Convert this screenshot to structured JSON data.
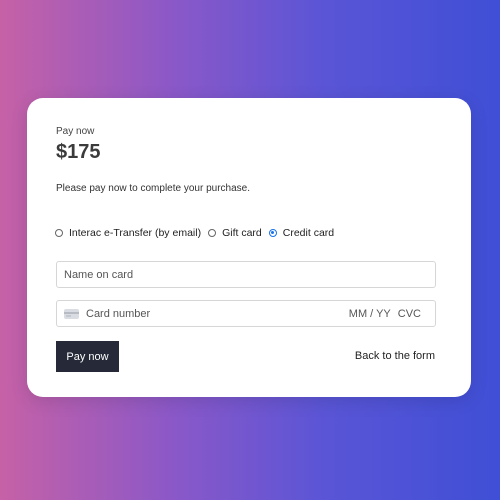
{
  "payment": {
    "label": "Pay now",
    "amount": "$175",
    "description": "Please pay now to complete your purchase."
  },
  "methods": [
    {
      "label": "Interac e-Transfer (by email)",
      "selected": false
    },
    {
      "label": "Gift card",
      "selected": false
    },
    {
      "label": "Credit card",
      "selected": true
    }
  ],
  "form": {
    "name_placeholder": "Name on card",
    "card_number_placeholder": "Card number",
    "expiry_placeholder": "MM / YY",
    "cvc_placeholder": "CVC"
  },
  "actions": {
    "pay_button": "Pay now",
    "back_link": "Back to the form"
  },
  "colors": {
    "button_bg": "#262a38",
    "radio_selected": "#1a73e8"
  }
}
